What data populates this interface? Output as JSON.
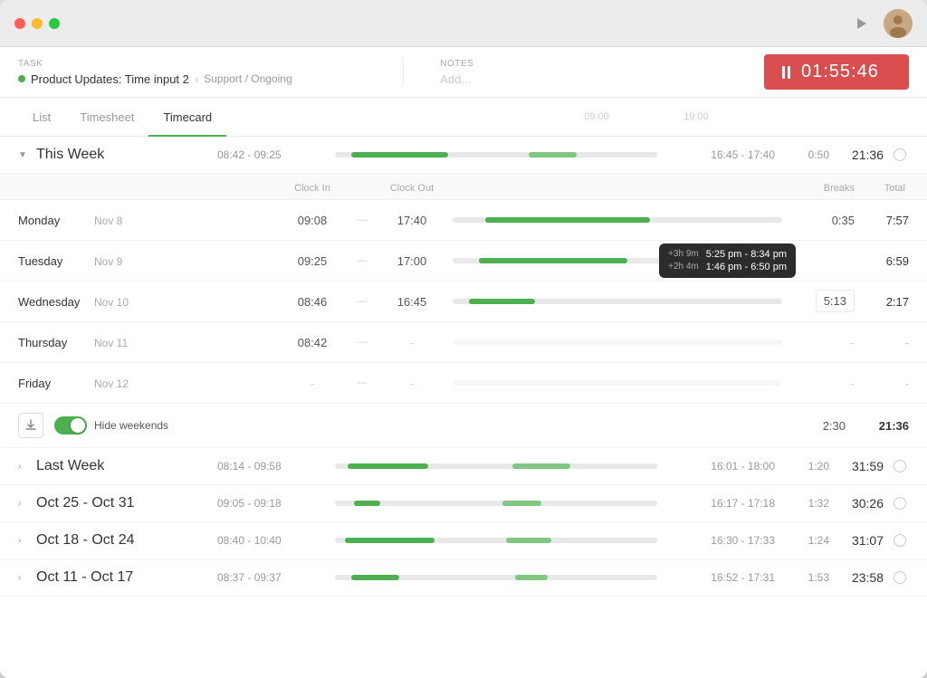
{
  "titlebar": {
    "app_icon": "⊙",
    "play_label": "play",
    "avatar_label": "U"
  },
  "taskbar": {
    "task_label": "Task",
    "task_name": "Product Updates: Time input 2",
    "task_path": "Support / Ongoing",
    "notes_label": "Notes",
    "notes_placeholder": "Add...",
    "timer_display": "01:55:46"
  },
  "tabs": [
    {
      "label": "List",
      "active": false
    },
    {
      "label": "Timesheet",
      "active": false
    },
    {
      "label": "Timecard",
      "active": true
    }
  ],
  "timeline_ticks": [
    "09:00",
    "19:00"
  ],
  "weeks": [
    {
      "title": "This Week",
      "expanded": true,
      "time_start": "08:42 - 09:25",
      "time_end": "16:45 - 17:40",
      "breaks": "0:50",
      "total": "21:36",
      "days": [
        {
          "name": "Monday",
          "date": "Nov 8",
          "clock_in": "09:08",
          "clock_out": "17:40",
          "breaks": "0:35",
          "total": "7:57"
        },
        {
          "name": "Tuesday",
          "date": "Nov 9",
          "clock_in": "09:25",
          "clock_out": "17:00",
          "breaks": "",
          "total": "6:59",
          "has_tooltip": true,
          "tooltip": [
            {
              "badge": "+3h 9m",
              "time": "5:25 pm - 8:34 pm"
            },
            {
              "badge": "+2h 4m",
              "time": "1:46 pm - 6:50 pm"
            }
          ]
        },
        {
          "name": "Wednesday",
          "date": "Nov 10",
          "clock_in": "08:46",
          "clock_out": "16:45",
          "breaks": "5:13",
          "breaks_highlight": true,
          "total": "2:17"
        },
        {
          "name": "Thursday",
          "date": "Nov 11",
          "clock_in": "08:42",
          "clock_out": "-",
          "breaks": "-",
          "total": "-"
        },
        {
          "name": "Friday",
          "date": "Nov 12",
          "clock_in": "-",
          "clock_out": "-",
          "breaks": "-",
          "total": "-"
        }
      ],
      "footer_breaks": "2:30",
      "footer_total": "21:36"
    },
    {
      "title": "Last Week",
      "expanded": false,
      "time_start": "08:14 - 09:58",
      "time_end": "16:01 - 18:00",
      "breaks": "1:20",
      "total": "31:59"
    },
    {
      "title": "Oct 25 - Oct 31",
      "expanded": false,
      "time_start": "09:05 - 09:18",
      "time_end": "16:17 - 17:18",
      "breaks": "1:32",
      "total": "30:26"
    },
    {
      "title": "Oct 18 - Oct 24",
      "expanded": false,
      "time_start": "08:40 - 10:40",
      "time_end": "16:30 - 17:33",
      "breaks": "1:24",
      "total": "31:07"
    },
    {
      "title": "Oct 11 - Oct 17",
      "expanded": false,
      "time_start": "08:37 - 09:37",
      "time_end": "16:52 - 17:31",
      "breaks": "1:53",
      "total": "23:58"
    }
  ],
  "column_headers": {
    "clock_in": "Clock In",
    "clock_out": "Clock Out",
    "breaks": "Breaks",
    "total": "Total"
  },
  "footer": {
    "hide_weekends_label": "Hide weekends",
    "download_label": "download"
  }
}
